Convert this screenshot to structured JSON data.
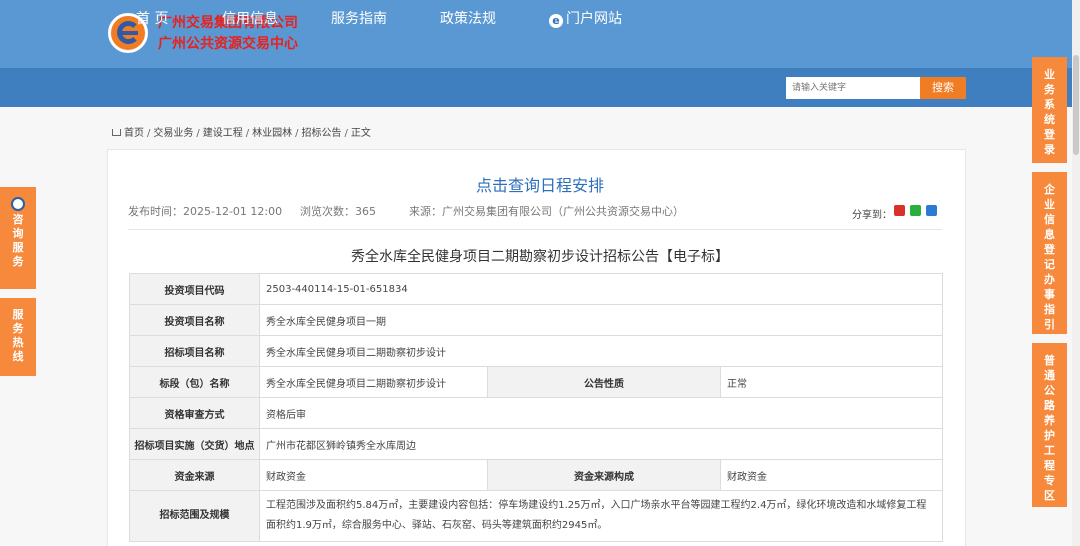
{
  "header": {
    "org_line1": "广州交易集团有限公司",
    "org_line2": "广州公共资源交易中心"
  },
  "nav": {
    "items": [
      {
        "label": "首 页"
      },
      {
        "label": "信用信息"
      },
      {
        "label": "服务指南"
      },
      {
        "label": "政策法规"
      },
      {
        "label": "门户网站",
        "icon": "ie-icon"
      }
    ],
    "search_placeholder": "请输入关键字",
    "search_button": "搜索"
  },
  "breadcrumb": {
    "items": [
      "首页",
      "交易业务",
      "建设工程",
      "林业园林",
      "招标公告",
      "正文"
    ]
  },
  "article": {
    "schedule_link": "点击查询日程安排",
    "publish_time": "发布时间：2025-12-01 12:00",
    "views": "浏览次数：365",
    "source": "来源：广州交易集团有限公司（广州公共资源交易中心）",
    "share_label": "分享到：",
    "title": "秀全水库全民健身项目二期勘察初步设计招标公告【电子标】",
    "rows": {
      "code_label": "投资项目代码",
      "code_value": "2503-440114-15-01-651834",
      "inv_name_label": "投资项目名称",
      "inv_name_value": "秀全水库全民健身项目一期",
      "bid_name_label": "招标项目名称",
      "bid_name_value": "秀全水库全民健身项目二期勘察初步设计",
      "section_label": "标段（包）名称",
      "section_value": "秀全水库全民健身项目二期勘察初步设计",
      "nature_label": "公告性质",
      "nature_value": "正常",
      "review_label": "资格审查方式",
      "review_value": "资格后审",
      "location_label": "招标项目实施（交货）地点",
      "location_value": "广州市花都区狮岭镇秀全水库周边",
      "fund_label": "资金来源",
      "fund_value": "财政资金",
      "fund_comp_label": "资金来源构成",
      "fund_comp_value": "财政资金",
      "scope_label": "招标范围及规模",
      "scope_value": "工程范围涉及面积约5.84万㎡，主要建设内容包括：停车场建设约1.25万㎡，入口广场亲水平台等园建工程约2.4万㎡，绿化环境改造和水域修复工程面积约1.9万㎡，综合服务中心、驿站、石灰窑、码头等建筑面积约2945㎡。"
    }
  },
  "left_tabs": {
    "consult": "咨询服务",
    "hotline": "服务热线"
  },
  "right_tabs": {
    "business_login": "业务系统登录",
    "enterprise_guide": "企业信息登记办事指引",
    "road_zone": "普通公路养护工程专区"
  },
  "colors": {
    "nav_blue": "#3f7fc0",
    "header_blue": "#5a98d3",
    "accent_orange": "#f6893b",
    "link_blue": "#2c6fbb",
    "org_red": "#e8211f"
  }
}
